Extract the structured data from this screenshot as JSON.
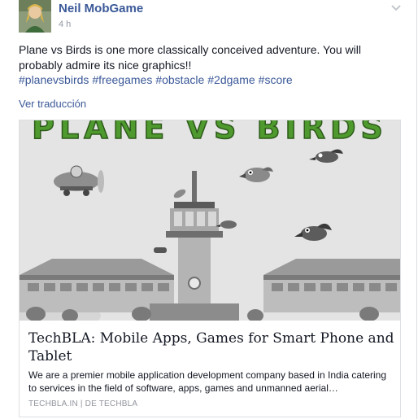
{
  "post": {
    "author": "Neil MobGame",
    "time": "4 h",
    "text": "Plane vs Birds is one more classically conceived adventure. You will probably admire its nice graphics!!",
    "hashtags": [
      "#planevsbirds",
      "#freegames",
      "#obstacle",
      "#2dgame",
      "#score"
    ],
    "translate_link": "Ver traducción"
  },
  "card": {
    "game_logo": "PLANE VS BIRDS",
    "title": "TechBLA: Mobile Apps, Games for Smart Phone and Tablet",
    "description": "We are a premier mobile application development company based in India catering to services in the field of software, apps, games and unmanned aerial…",
    "source": "TECHBLA.IN | DE TECHBLA"
  },
  "colors": {
    "link": "#3b5998",
    "logo_green": "#4f9a2e",
    "logo_red": "#c42a2a"
  }
}
